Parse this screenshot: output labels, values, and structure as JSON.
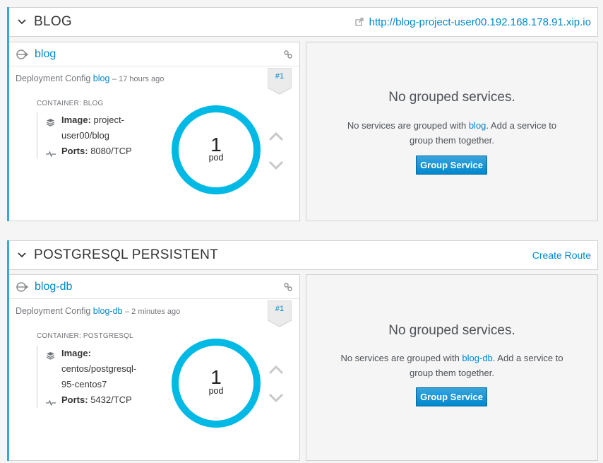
{
  "apps": [
    {
      "title": "BLOG",
      "route_url": "http://blog-project-user00.192.168.178.91.xip.io",
      "create_route_label": "",
      "service": {
        "name": "blog",
        "dc_prefix": "Deployment Config",
        "dc_name": "blog",
        "dc_age": "– 17 hours ago",
        "revision": "#1",
        "container_label": "CONTAINER: BLOG",
        "image_label": "Image:",
        "image_value_1": "project-",
        "image_value_2": "user00/blog",
        "image_value_3": "",
        "ports_label": "Ports:",
        "ports_value": "8080/TCP",
        "pod_count": "1",
        "pod_label": "pod"
      },
      "grouped": {
        "title": "No grouped services.",
        "desc_pre": "No services are grouped with",
        "desc_link": "blog",
        "desc_post_1": ". Add a service to",
        "desc_post_2": "group them together.",
        "button": "Group Service"
      }
    },
    {
      "title": "POSTGRESQL PERSISTENT",
      "route_url": "",
      "create_route_label": "Create Route",
      "service": {
        "name": "blog-db",
        "dc_prefix": "Deployment Config",
        "dc_name": "blog-db",
        "dc_age": "– 2 minutes ago",
        "revision": "#1",
        "container_label": "CONTAINER: POSTGRESQL",
        "image_label": "Image:",
        "image_value_1": "",
        "image_value_2": "centos/postgresql-",
        "image_value_3": "95-centos7",
        "ports_label": "Ports:",
        "ports_value": "5432/TCP",
        "pod_count": "1",
        "pod_label": "pod"
      },
      "grouped": {
        "title": "No grouped services.",
        "desc_pre": "No services are grouped with",
        "desc_link": "blog-db",
        "desc_post_1": ". Add a service",
        "desc_post_2": "to group them together.",
        "button": "Group Service"
      }
    }
  ],
  "icons": {
    "collapse": "chevron-down-icon",
    "external_link": "external-link-icon",
    "service": "service-icon",
    "link": "link-icon",
    "image": "layers-icon",
    "ports": "pulse-icon",
    "scale_up": "chevron-up-icon",
    "scale_down": "chevron-down-icon"
  },
  "colors": {
    "accent": "#39a5dc",
    "link": "#0088ce",
    "donut": "#00b9e4"
  }
}
